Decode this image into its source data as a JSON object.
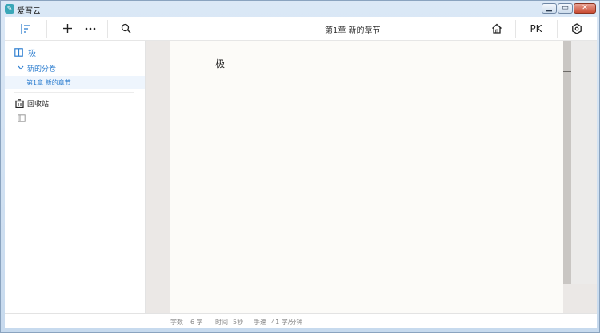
{
  "window": {
    "title": "爱写云",
    "icon": "app-logo-icon",
    "controls": [
      "minimize",
      "maximize",
      "close"
    ]
  },
  "toolbar": {
    "chapter_title": "第1章  新的章节",
    "pk_label": "PK",
    "icons": [
      "outline-toggle-icon",
      "plus-icon",
      "more-icon",
      "search-icon",
      "home-icon",
      "settings-icon"
    ]
  },
  "sidebar": {
    "book_title": "极",
    "volume_title": "新的分卷",
    "chapter_item": "第1章   新的章节",
    "trash_label": "回收站"
  },
  "editor": {
    "content": "极"
  },
  "status": {
    "word_count_label": "字数",
    "word_count_value": "6 字",
    "time_label": "时间",
    "time_value": "5秒",
    "speed_label": "手速",
    "speed_value": "41 字/分钟"
  },
  "colors": {
    "accent": "#2f7fd0",
    "paper": "#fcfbf8",
    "editor_bg": "#ebe8e6"
  }
}
